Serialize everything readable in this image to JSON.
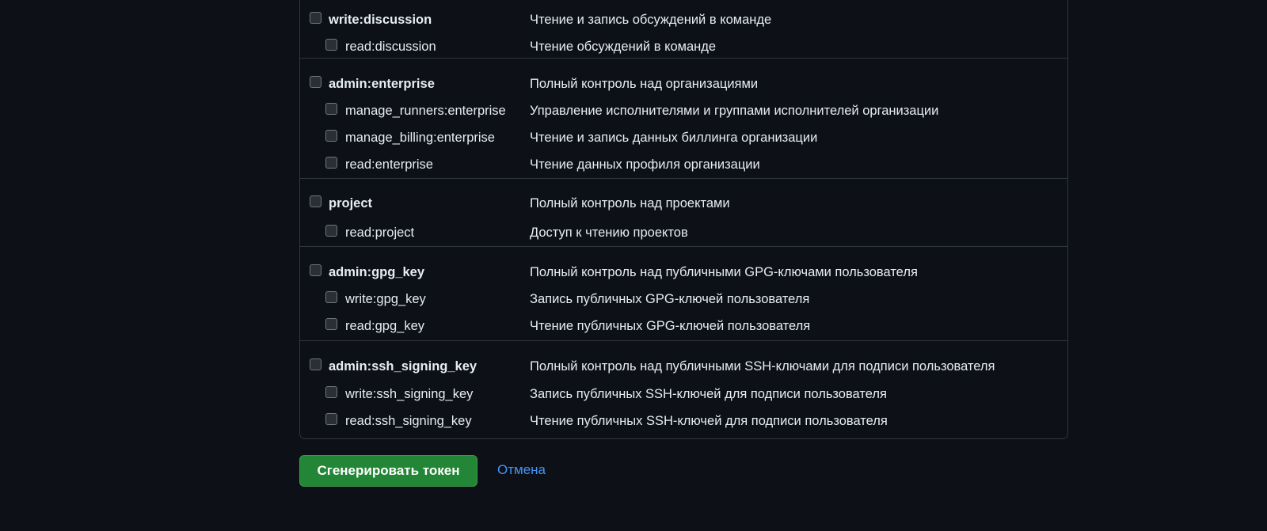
{
  "scope_groups": [
    {
      "parent": {
        "name": "write:discussion",
        "desc": "Чтение и запись обсуждений в команде"
      },
      "children": [
        {
          "name": "read:discussion",
          "desc": "Чтение обсуждений в команде"
        }
      ]
    },
    {
      "parent": {
        "name": "admin:enterprise",
        "desc": "Полный контроль над организациями"
      },
      "children": [
        {
          "name": "manage_runners:enterprise",
          "desc": "Управление исполнителями и группами исполнителей организации"
        },
        {
          "name": "manage_billing:enterprise",
          "desc": "Чтение и запись данных биллинга организации"
        },
        {
          "name": "read:enterprise",
          "desc": "Чтение данных профиля организации"
        }
      ]
    },
    {
      "parent": {
        "name": "project",
        "desc": "Полный контроль над проектами"
      },
      "children": [
        {
          "name": "read:project",
          "desc": "Доступ к чтению проектов"
        }
      ]
    },
    {
      "parent": {
        "name": "admin:gpg_key",
        "desc": "Полный контроль над публичными GPG-ключами пользователя"
      },
      "children": [
        {
          "name": "write:gpg_key",
          "desc": "Запись публичных GPG-ключей пользователя"
        },
        {
          "name": "read:gpg_key",
          "desc": "Чтение публичных GPG-ключей пользователя"
        }
      ]
    },
    {
      "parent": {
        "name": "admin:ssh_signing_key",
        "desc": "Полный контроль над публичными SSH-ключами для подписи пользователя"
      },
      "children": [
        {
          "name": "write:ssh_signing_key",
          "desc": "Запись публичных SSH-ключей для подписи пользователя"
        },
        {
          "name": "read:ssh_signing_key",
          "desc": "Чтение публичных SSH-ключей для подписи пользователя"
        }
      ]
    }
  ],
  "actions": {
    "generate_label": "Сгенерировать токен",
    "cancel_label": "Отмена"
  },
  "colors": {
    "background": "#0d1117",
    "border": "#30363d",
    "primary_button": "#238636",
    "link": "#4493f8"
  }
}
